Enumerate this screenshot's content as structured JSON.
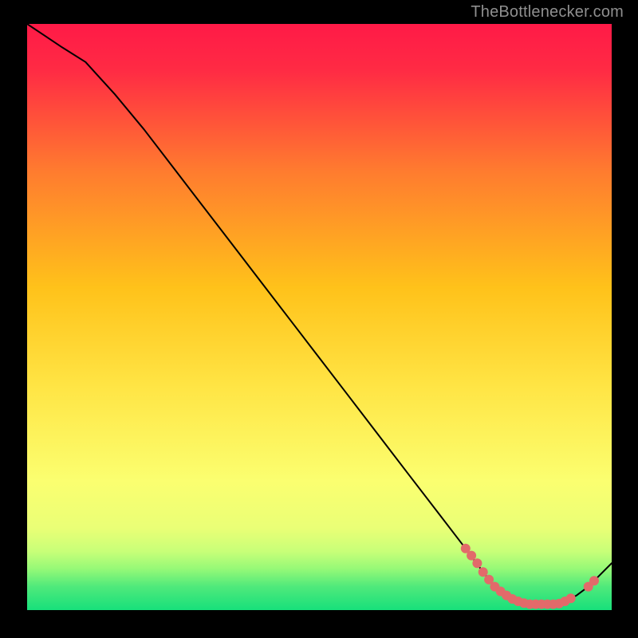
{
  "attribution": "TheBottlenecker.com",
  "colors": {
    "page_bg": "#000000",
    "gradient_top": "#ff1a47",
    "gradient_mid": "#ffd400",
    "gradient_low": "#f6ff7a",
    "gradient_bottom": "#17e07b",
    "curve": "#000000",
    "marker": "#e26a6a",
    "attribution": "#8f8f8f"
  },
  "chart_data": {
    "type": "line",
    "title": "",
    "xlabel": "",
    "ylabel": "",
    "xlim": [
      0,
      100
    ],
    "ylim": [
      0,
      100
    ],
    "x": [
      0,
      3,
      6,
      10,
      15,
      20,
      25,
      30,
      35,
      40,
      45,
      50,
      55,
      60,
      65,
      70,
      75,
      78,
      80,
      82,
      84,
      86,
      88,
      90,
      92,
      94,
      96,
      98,
      100
    ],
    "values": [
      100,
      98,
      96,
      93.5,
      88,
      82,
      75.5,
      69,
      62.5,
      56,
      49.5,
      43,
      36.5,
      30,
      23.5,
      17,
      10.5,
      6.5,
      4,
      2.5,
      1.5,
      1,
      1,
      1,
      1.5,
      2.5,
      4,
      6,
      8
    ],
    "markers": {
      "x": [
        75,
        76,
        77,
        78,
        79,
        80,
        81,
        82,
        83,
        84,
        85,
        86,
        87,
        88,
        89,
        90,
        91,
        92,
        93,
        96,
        97
      ],
      "y": [
        10.5,
        9.3,
        8,
        6.5,
        5.2,
        4,
        3.2,
        2.5,
        1.9,
        1.5,
        1.2,
        1,
        1,
        1,
        1,
        1,
        1.1,
        1.5,
        2,
        4,
        5
      ]
    }
  }
}
